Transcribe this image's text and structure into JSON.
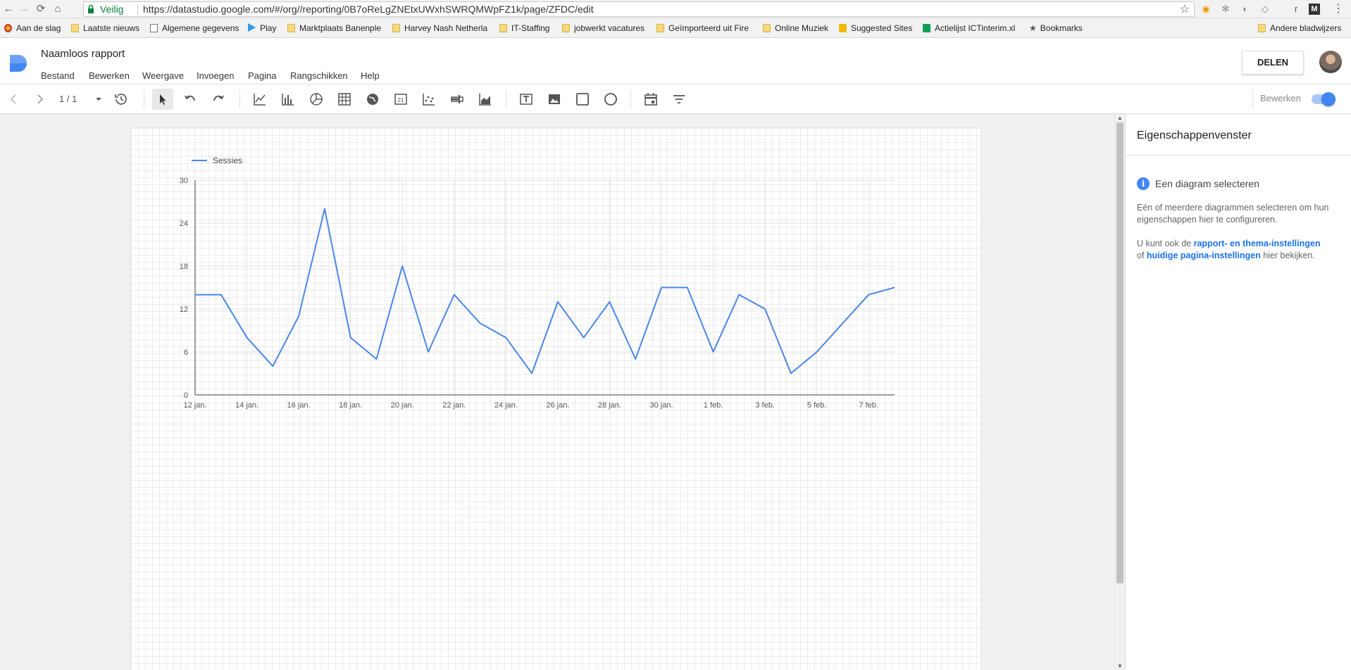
{
  "browser": {
    "secure_label": "Veilig",
    "url": "https://datastudio.google.com/#/org//reporting/0B7oReLgZNEtxUWxhSWRQMWpFZ1k/page/ZFDC/edit",
    "extension_letter": "r"
  },
  "bookmarks": {
    "items": [
      {
        "label": "Aan de slag"
      },
      {
        "label": "Laatste nieuws"
      },
      {
        "label": "Algemene gegevens"
      },
      {
        "label": "Play"
      },
      {
        "label": "Marktplaats Banenple"
      },
      {
        "label": "Harvey Nash Netherla"
      },
      {
        "label": "IT-Staffing"
      },
      {
        "label": "jobwerkt vacatures"
      },
      {
        "label": "Geïmporteerd uit Fire"
      },
      {
        "label": "Online Muziek"
      },
      {
        "label": "Suggested Sites"
      },
      {
        "label": "Actielijst ICTinterim.xl"
      },
      {
        "label": "Bookmarks"
      }
    ],
    "other_label": "Andere bladwijzers"
  },
  "app": {
    "title": "Naamloos rapport",
    "menu": [
      "Bestand",
      "Bewerken",
      "Weergave",
      "Invoegen",
      "Pagina",
      "Rangschikken",
      "Help"
    ],
    "share_label": "DELEN"
  },
  "toolbar": {
    "page_indicator": "1 / 1",
    "edit_toggle_label": "Bewerken",
    "edit_mode_on": true
  },
  "properties": {
    "title": "Eigenschappenvenster",
    "heading": "Een diagram selecteren",
    "paragraph1": "Eén of meerdere diagrammen selecteren om hun eigenschappen hier te configureren.",
    "p2_prefix": "U kunt ook de ",
    "p2_link1": "rapport- en thema-instellingen",
    "p2_mid": "of ",
    "p2_link2": "huidige pagina-instellingen",
    "p2_suffix": " hier bekijken."
  },
  "colors": {
    "accent": "#4285f4",
    "series": "#4a86e8",
    "link": "#1a73e8"
  },
  "chart_data": {
    "type": "line",
    "legend_position": "top-left",
    "series": [
      {
        "name": "Sessies",
        "values": [
          14,
          14,
          8,
          4,
          11,
          26,
          8,
          5,
          18,
          6,
          14,
          10,
          8,
          3,
          13,
          8,
          13,
          5,
          15,
          15,
          6,
          14,
          12,
          3,
          6,
          10,
          14,
          15
        ]
      }
    ],
    "x_tick_labels": [
      "12 jan.",
      "14 jan.",
      "16 jan.",
      "18 jan.",
      "20 jan.",
      "22 jan.",
      "24 jan.",
      "26 jan.",
      "28 jan.",
      "30 jan.",
      "1 feb.",
      "3 feb.",
      "5 feb.",
      "7 feb."
    ],
    "y_ticks": [
      0,
      6,
      12,
      18,
      24,
      30
    ],
    "ylim": [
      0,
      30
    ],
    "grid": true
  }
}
